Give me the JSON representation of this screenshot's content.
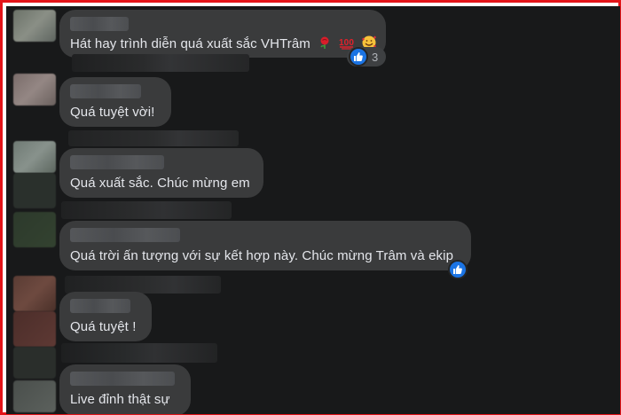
{
  "comments": [
    {
      "text": "Hát hay trình diễn quá xuất sắc VHTrâm",
      "emojis": [
        "rose-emoji",
        "hundred-points-emoji",
        "smiling-face-with-hearts-emoji"
      ],
      "reaction": "like",
      "reaction_count": "3"
    },
    {
      "text": "Quá tuyệt vời!"
    },
    {
      "text": "Quá xuất sắc. Chúc mừng em"
    },
    {
      "text": "Quá trời ấn tượng với sự kết hợp này. Chúc mừng Trâm và ekip",
      "reaction": "like"
    },
    {
      "text": "Quá tuyệt !"
    },
    {
      "text": "Live đỉnh thật sự"
    }
  ],
  "colors": {
    "frame_border": "#e3151a",
    "background": "#18191a",
    "bubble": "#3a3b3c",
    "text": "#e4e6eb",
    "like_blue": "#1b74e4"
  }
}
